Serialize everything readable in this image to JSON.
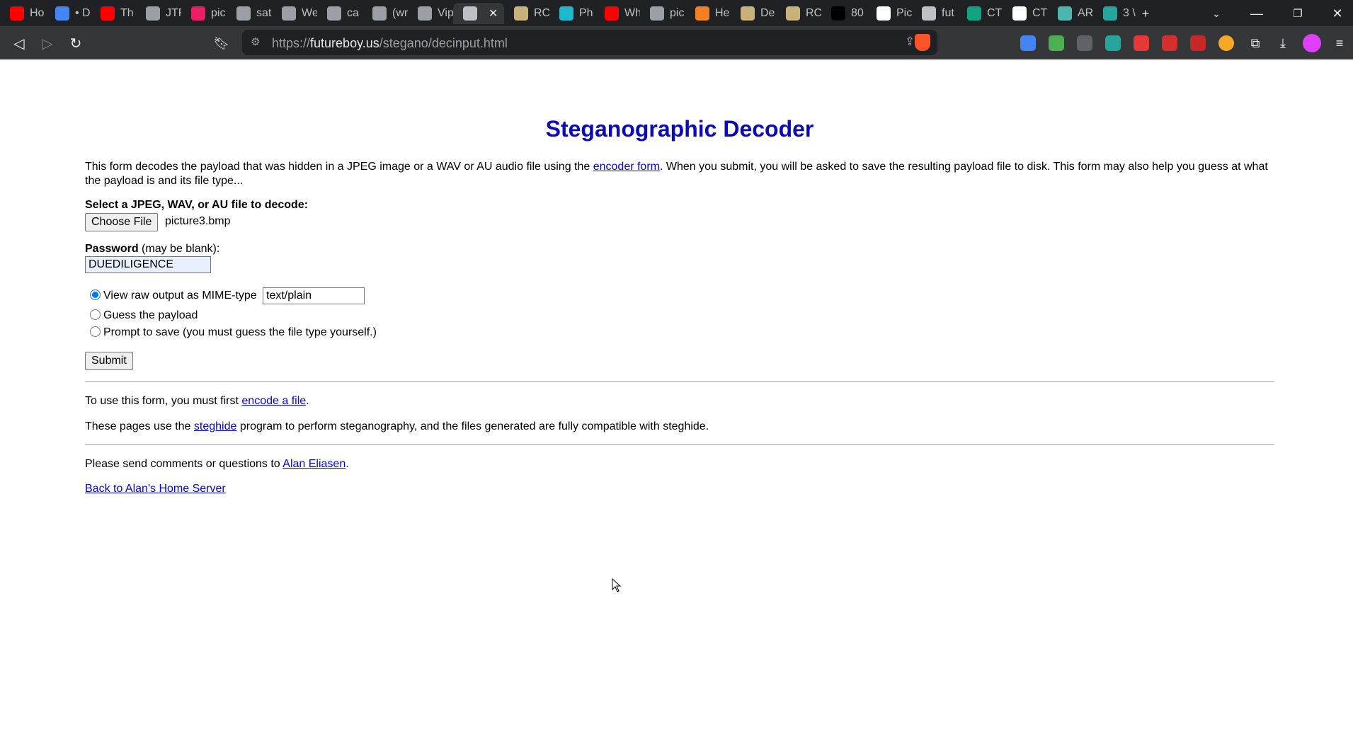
{
  "browser": {
    "tabs": [
      {
        "label": "Ho",
        "icon": "youtube-icon",
        "color": "#ff0000"
      },
      {
        "label": "• D",
        "icon": "google-icon",
        "color": "#4285f4"
      },
      {
        "label": "Th",
        "icon": "youtube-icon",
        "color": "#ff0000"
      },
      {
        "label": "JTF",
        "icon": "globe-icon",
        "color": "#9aa0a6"
      },
      {
        "label": "pic",
        "icon": "picsart-icon",
        "color": "#e91e63"
      },
      {
        "label": "sat",
        "icon": "globe-icon",
        "color": "#9aa0a6"
      },
      {
        "label": "We",
        "icon": "globe-icon",
        "color": "#9aa0a6"
      },
      {
        "label": "ca",
        "icon": "globe-icon",
        "color": "#9aa0a6"
      },
      {
        "label": "(wr",
        "icon": "document-icon",
        "color": "#9aa0a6"
      },
      {
        "label": "Vip",
        "icon": "globe-icon",
        "color": "#9aa0a6"
      },
      {
        "label": "",
        "icon": "stego-icon",
        "color": "#bdc1c6",
        "active": true
      },
      {
        "label": "RC",
        "icon": "scroll-icon",
        "color": "#c8b27a"
      },
      {
        "label": "Ph",
        "icon": "perplexity-icon",
        "color": "#20b8cd"
      },
      {
        "label": "Wh",
        "icon": "youtube-icon",
        "color": "#ff0000"
      },
      {
        "label": "pic",
        "icon": "document-icon",
        "color": "#9aa0a6"
      },
      {
        "label": "He",
        "icon": "r-icon",
        "color": "#f48024"
      },
      {
        "label": "De",
        "icon": "scroll-icon",
        "color": "#c8b27a"
      },
      {
        "label": "RC",
        "icon": "scroll-icon",
        "color": "#c8b27a"
      },
      {
        "label": "80",
        "icon": "terminal-icon",
        "color": "#000000"
      },
      {
        "label": "Pic",
        "icon": "medium-icon",
        "color": "#ffffff"
      },
      {
        "label": "fut",
        "icon": "stego-icon",
        "color": "#bdc1c6"
      },
      {
        "label": "CT",
        "icon": "chatgpt-icon",
        "color": "#10a37f"
      },
      {
        "label": "CT",
        "icon": "github-icon",
        "color": "#ffffff"
      },
      {
        "label": "AR",
        "icon": "flag-icon",
        "color": "#4db6ac"
      },
      {
        "label": "3 \\",
        "icon": "puzzle-color-icon",
        "color": "#26a69a"
      }
    ],
    "url_prefix": "https://",
    "url_host": "futureboy.us",
    "url_path": "/stegano/decinput.html"
  },
  "page": {
    "title": "Steganographic Decoder",
    "intro_before_link": "This form decodes the payload that was hidden in a JPEG image or a WAV or AU audio file using the ",
    "intro_link": "encoder form",
    "intro_after_link": ". When you submit, you will be asked to save the resulting payload file to disk. This form may also help you guess at what the payload is and its file type...",
    "file_label": "Select a JPEG, WAV, or AU file to decode:",
    "choose_file_button": "Choose File",
    "chosen_file": "picture3.bmp",
    "password_label": "Password",
    "password_hint": " (may be blank):",
    "password_value": "DUEDILIGENCE",
    "options": [
      {
        "label": "View raw output as MIME-type",
        "checked": true
      },
      {
        "label": "Guess the payload",
        "checked": false
      },
      {
        "label": "Prompt to save (you must guess the file type yourself.)",
        "checked": false
      }
    ],
    "mime_value": "text/plain",
    "submit_button": "Submit",
    "encode_before": "To use this form, you must first ",
    "encode_link": "encode a file",
    "encode_after": ".",
    "steghide_before": "These pages use the ",
    "steghide_link": "steghide",
    "steghide_after": " program to perform steganography, and the files generated are fully compatible with steghide.",
    "comments_before": "Please send comments or questions to ",
    "comments_link": "Alan Eliasen",
    "comments_after": ".",
    "back_link": "Back to Alan's Home Server"
  }
}
